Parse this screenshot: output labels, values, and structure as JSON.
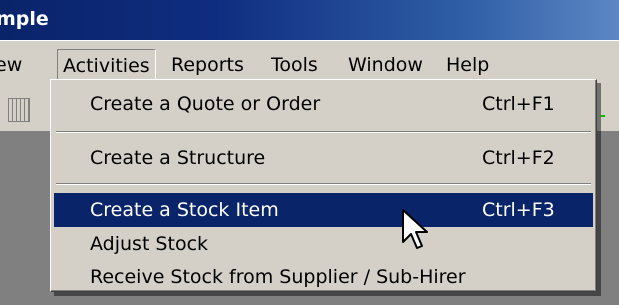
{
  "window": {
    "title": "mple"
  },
  "menubar": {
    "items": [
      "ew",
      "Activities",
      "Reports",
      "Tools",
      "Window",
      "Help"
    ]
  },
  "dropdown": {
    "items": [
      {
        "label": "Create a Quote or Order",
        "shortcut": "Ctrl+F1",
        "highlighted": false
      },
      {
        "label": "Create a Structure",
        "shortcut": "Ctrl+F2",
        "highlighted": false
      },
      {
        "label": "Create a Stock Item",
        "shortcut": "Ctrl+F3",
        "highlighted": true
      },
      {
        "label": "Adjust Stock",
        "shortcut": "",
        "highlighted": false
      },
      {
        "label": "Receive Stock from Supplier / Sub-Hirer",
        "shortcut": "",
        "highlighted": false
      }
    ]
  },
  "colors": {
    "menu_bg": "#d4d0c8",
    "highlight_bg": "#0a246a",
    "highlight_text": "#ffffff",
    "title_gradient_start": "#0a246a",
    "title_gradient_end": "#5d87c4"
  },
  "icons": {
    "cursor": "arrow-pointer-icon",
    "toolbar_button": "grid-icon"
  }
}
